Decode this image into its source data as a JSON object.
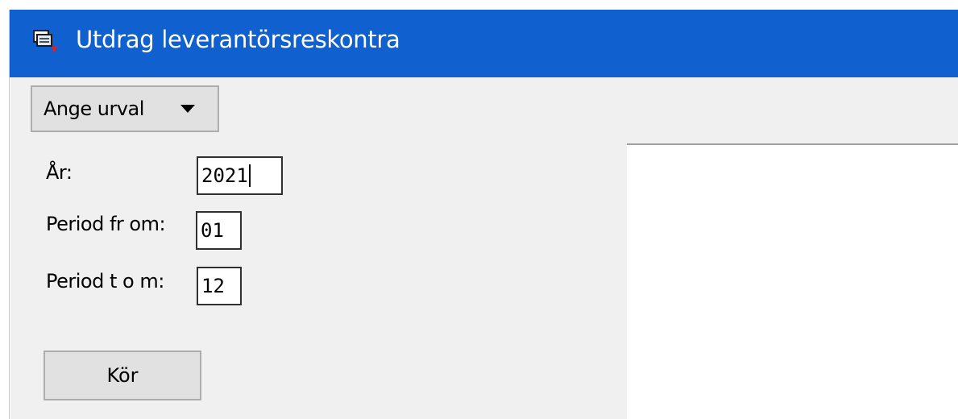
{
  "window": {
    "title": "Utdrag leverantörsreskontra",
    "title_bar_color": "#1060d0",
    "icon": "ledger-app-icon"
  },
  "toolbar": {
    "selection_button_label": "Ange urval",
    "selection_dropdown_icon": "caret-down-icon"
  },
  "form": {
    "year": {
      "label": "År:",
      "value": "2021"
    },
    "period_from": {
      "label": "Period fr om:",
      "value": "01"
    },
    "period_to": {
      "label": "Period t o m:",
      "value": "12"
    },
    "run_button_label": "Kör"
  }
}
